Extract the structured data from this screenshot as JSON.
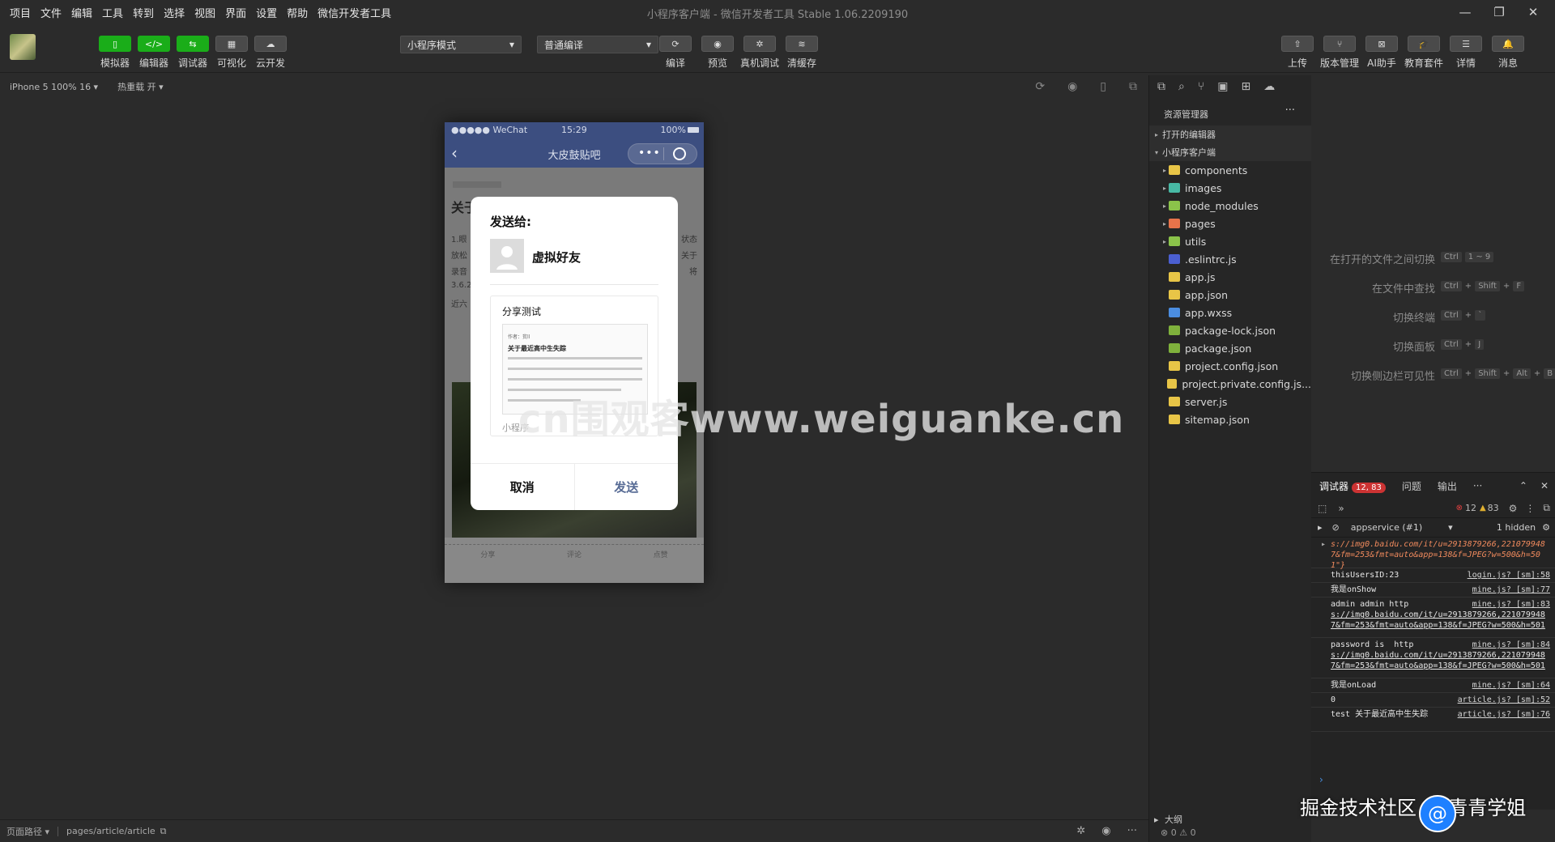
{
  "window": {
    "title": "小程序客户端 - 微信开发者工具 Stable 1.06.2209190",
    "controls": [
      "—",
      "❐",
      "✕"
    ]
  },
  "menu": [
    "项目",
    "文件",
    "编辑",
    "工具",
    "转到",
    "选择",
    "视图",
    "界面",
    "设置",
    "帮助",
    "微信开发者工具"
  ],
  "toolbar": {
    "left_tools": [
      {
        "label": "模拟器",
        "icon": "▯"
      },
      {
        "label": "编辑器",
        "icon": "</>"
      },
      {
        "label": "调试器",
        "icon": "⇆"
      },
      {
        "label": "可视化",
        "icon": "▦"
      },
      {
        "label": "云开发",
        "icon": "☁"
      }
    ],
    "mode_select": "小程序模式",
    "compile_select": "普通编译",
    "center_tools": [
      {
        "label": "编译",
        "icon": "⟳"
      },
      {
        "label": "预览",
        "icon": "◉"
      },
      {
        "label": "真机调试",
        "icon": "✲"
      },
      {
        "label": "清缓存",
        "icon": "≋"
      }
    ],
    "right_tools": [
      {
        "label": "上传",
        "icon": "⇧"
      },
      {
        "label": "版本管理",
        "icon": "⑂"
      },
      {
        "label": "AI助手",
        "icon": "⊠"
      },
      {
        "label": "教育套件",
        "icon": "🎓"
      },
      {
        "label": "详情",
        "icon": "☰"
      },
      {
        "label": "消息",
        "icon": "🔔"
      }
    ]
  },
  "subbar": {
    "device": "iPhone 5 100% 16 ▾",
    "hot_reload": "热重载 开 ▾"
  },
  "simulator": {
    "status": {
      "carrier": "●●●●● WeChat",
      "time": "15:29",
      "battery": "100%"
    },
    "nav_title": "大皮鼓贴吧",
    "article": {
      "heading": "关于",
      "lines": [
        "1.眼",
        "放松",
        "录音",
        "3.6.2",
        "近六"
      ],
      "right_lines": [
        "状态",
        "关于",
        "将"
      ]
    },
    "footer_actions": [
      "分享",
      "评论",
      "点赞"
    ]
  },
  "share_modal": {
    "send_to": "发送给:",
    "friend_name": "虚拟好友",
    "card_title": "分享测试",
    "thumb_author": "作者：贫ll",
    "thumb_title": "关于最近高中生失踪",
    "mini_program": "小程序",
    "cancel": "取消",
    "send": "发送"
  },
  "watermarks": {
    "center": "cn围观客www.weiguanke.cn",
    "bottom_right": "掘金技术社区 @ 青青学姐"
  },
  "explorer": {
    "title": "资源管理器",
    "more": "···",
    "open_editors": "打开的编辑器",
    "project": "小程序客户端",
    "items": [
      {
        "name": "components",
        "type": "folder",
        "color": "#e8c547"
      },
      {
        "name": "images",
        "type": "folder",
        "color": "#48b9a5"
      },
      {
        "name": "node_modules",
        "type": "folder",
        "color": "#8bc34a"
      },
      {
        "name": "pages",
        "type": "folder",
        "color": "#e8734a"
      },
      {
        "name": "utils",
        "type": "folder",
        "color": "#8bc34a"
      },
      {
        "name": ".eslintrc.js",
        "type": "file",
        "color": "#4b5fd1"
      },
      {
        "name": "app.js",
        "type": "file",
        "color": "#e8c547"
      },
      {
        "name": "app.json",
        "type": "file",
        "color": "#e8c547"
      },
      {
        "name": "app.wxss",
        "type": "file",
        "color": "#4b8de0"
      },
      {
        "name": "package-lock.json",
        "type": "file",
        "color": "#7fb13c"
      },
      {
        "name": "package.json",
        "type": "file",
        "color": "#7fb13c"
      },
      {
        "name": "project.config.json",
        "type": "file",
        "color": "#e8c547"
      },
      {
        "name": "project.private.config.js...",
        "type": "file",
        "color": "#e8c547"
      },
      {
        "name": "server.js",
        "type": "file",
        "color": "#e8c547"
      },
      {
        "name": "sitemap.json",
        "type": "file",
        "color": "#e8c547"
      }
    ],
    "outline": "大纲",
    "problems": "⊗ 0 ⚠ 0"
  },
  "shortcuts": [
    {
      "label": "在打开的文件之间切换",
      "keys": [
        "Ctrl",
        "1 ~ 9"
      ]
    },
    {
      "label": "在文件中查找",
      "keys": [
        "Ctrl",
        "+",
        "Shift",
        "+",
        "F"
      ]
    },
    {
      "label": "切换终端",
      "keys": [
        "Ctrl",
        "+",
        "`"
      ]
    },
    {
      "label": "切换面板",
      "keys": [
        "Ctrl",
        "+",
        "J"
      ]
    },
    {
      "label": "切换侧边栏可见性",
      "keys": [
        "Ctrl",
        "+",
        "Shift",
        "+",
        "Alt",
        "+",
        "B"
      ]
    }
  ],
  "console": {
    "tabs": [
      "调试器",
      "问题",
      "输出",
      "···"
    ],
    "badge": "12, 83",
    "errors": "12",
    "warnings": "83",
    "context": "appservice (#1)",
    "hidden": "1 hidden",
    "logs": [
      {
        "msg": "",
        "url": "s://img0.baidu.com/it/u=2913879266,2210799487&fm=253&fmt=auto&app=138&f=JPEG?w=500&h=501\"}",
        "src": ""
      },
      {
        "msg": "thisUsersID:23",
        "url": "",
        "src": "login.js? [sm]:58"
      },
      {
        "msg": "我是onShow",
        "url": "",
        "src": "mine.js? [sm]:77"
      },
      {
        "msg": "admin admin http",
        "url": "s://img0.baidu.com/it/u=2913879266,2210799487&fm=253&fmt=auto&app=138&f=JPEG?w=500&h=501",
        "src": "mine.js? [sm]:83"
      },
      {
        "msg": "password is  http",
        "url": "s://img0.baidu.com/it/u=2913879266,2210799487&fm=253&fmt=auto&app=138&f=JPEG?w=500&h=501",
        "src": "mine.js? [sm]:84"
      },
      {
        "msg": "我是onLoad",
        "url": "",
        "src": "mine.js? [sm]:64"
      },
      {
        "msg": "0",
        "url": "",
        "src": "article.js? [sm]:52"
      },
      {
        "msg": "test 关于最近高中生失踪",
        "url": "",
        "src": "article.js? [sm]:76"
      }
    ]
  },
  "statusbar": {
    "path_label": "页面路径 ▾",
    "path": "pages/article/article"
  }
}
